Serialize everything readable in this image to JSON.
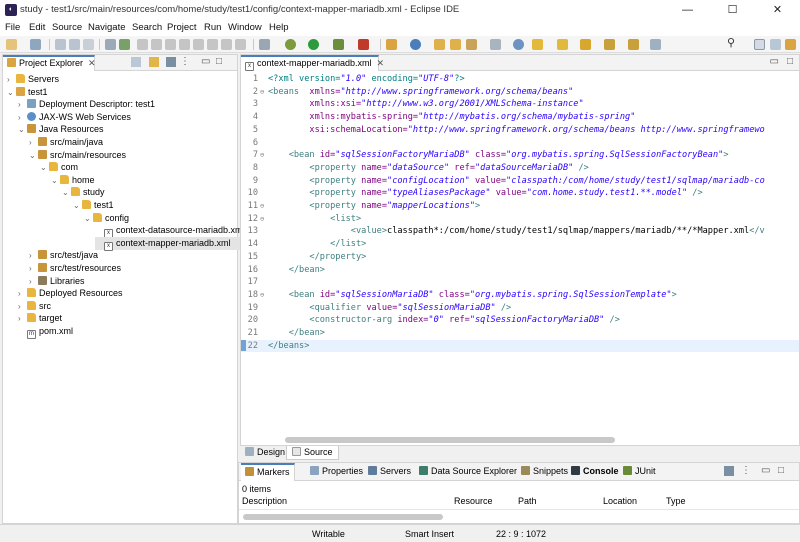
{
  "window": {
    "title": "study - test1/src/main/resources/com/home/study/test1/config/context-mapper-mariadb.xml - Eclipse IDE",
    "minimize": "—",
    "maximize": "☐",
    "close": "✕"
  },
  "menu": [
    "File",
    "Edit",
    "Source",
    "Navigate",
    "Search",
    "Project",
    "Run",
    "Window",
    "Help"
  ],
  "explorer": {
    "title": "Project Explorer",
    "close": "✕",
    "items": [
      {
        "label": "Servers",
        "icon": "folder-icon",
        "toggle": "›",
        "level": 0
      },
      {
        "label": "test1",
        "icon": "project-icon",
        "toggle": "⌄",
        "level": 0
      },
      {
        "label": "Deployment Descriptor: test1",
        "icon": "descriptor-icon",
        "toggle": "›",
        "level": 1
      },
      {
        "label": "JAX-WS Web Services",
        "icon": "web-services-icon",
        "toggle": "›",
        "level": 1
      },
      {
        "label": "Java Resources",
        "icon": "java-resources-icon",
        "toggle": "⌄",
        "level": 1
      },
      {
        "label": "src/main/java",
        "icon": "source-folder-icon",
        "toggle": "›",
        "level": 2
      },
      {
        "label": "src/main/resources",
        "icon": "source-folder-icon",
        "toggle": "⌄",
        "level": 2
      },
      {
        "label": "com",
        "icon": "folder-icon",
        "toggle": "⌄",
        "level": 3
      },
      {
        "label": "home",
        "icon": "folder-icon",
        "toggle": "⌄",
        "level": 4
      },
      {
        "label": "study",
        "icon": "folder-icon",
        "toggle": "⌄",
        "level": 5
      },
      {
        "label": "test1",
        "icon": "folder-icon",
        "toggle": "⌄",
        "level": 6
      },
      {
        "label": "config",
        "icon": "folder-icon",
        "toggle": "⌄",
        "level": 7
      },
      {
        "label": "context-datasource-mariadb.xm",
        "icon": "xml-file-icon",
        "toggle": "",
        "level": 8
      },
      {
        "label": "context-mapper-mariadb.xml",
        "icon": "xml-file-icon",
        "toggle": "",
        "level": 8,
        "selected": true
      },
      {
        "label": "src/test/java",
        "icon": "source-folder-icon",
        "toggle": "›",
        "level": 2
      },
      {
        "label": "src/test/resources",
        "icon": "source-folder-icon",
        "toggle": "›",
        "level": 2
      },
      {
        "label": "Libraries",
        "icon": "library-icon",
        "toggle": "›",
        "level": 2
      },
      {
        "label": "Deployed Resources",
        "icon": "folder-icon",
        "toggle": "›",
        "level": 1
      },
      {
        "label": "src",
        "icon": "folder-icon",
        "toggle": "›",
        "level": 1
      },
      {
        "label": "target",
        "icon": "folder-icon",
        "toggle": "›",
        "level": 1
      },
      {
        "label": "pom.xml",
        "icon": "maven-file-icon",
        "toggle": "",
        "level": 1
      }
    ]
  },
  "editor": {
    "tab": "context-mapper-mariadb.xml",
    "close": "✕",
    "lines": [
      {
        "n": "1",
        "fold": "",
        "segs": [
          [
            "decl",
            "<?xml version="
          ],
          [
            "val",
            "\"1.0\""
          ],
          [
            "decl",
            " encoding="
          ],
          [
            "val",
            "\"UTF-8\""
          ],
          [
            "decl",
            "?>"
          ]
        ]
      },
      {
        "n": "2",
        "fold": "⊖",
        "segs": [
          [
            "tag",
            "<beans  "
          ],
          [
            "attr",
            "xmlns="
          ],
          [
            "val",
            "\"http://www.springframework.org/schema/beans\""
          ]
        ]
      },
      {
        "n": "3",
        "fold": "",
        "segs": [
          [
            "text",
            "        "
          ],
          [
            "attr",
            "xmlns:xsi="
          ],
          [
            "val",
            "\"http://www.w3.org/2001/XMLSchema-instance\""
          ]
        ]
      },
      {
        "n": "4",
        "fold": "",
        "segs": [
          [
            "text",
            "        "
          ],
          [
            "attr",
            "xmlns:mybatis-spring="
          ],
          [
            "val",
            "\"http://mybatis.org/schema/mybatis-spring\""
          ]
        ]
      },
      {
        "n": "5",
        "fold": "",
        "segs": [
          [
            "text",
            "        "
          ],
          [
            "attr",
            "xsi:schemaLocation="
          ],
          [
            "val",
            "\"http://www.springframework.org/schema/beans http://www.springframewo"
          ]
        ]
      },
      {
        "n": "6",
        "fold": "",
        "segs": []
      },
      {
        "n": "7",
        "fold": "⊖",
        "segs": [
          [
            "text",
            "    "
          ],
          [
            "tag",
            "<bean "
          ],
          [
            "attr",
            "id="
          ],
          [
            "val",
            "\"sqlSessionFactoryMariaDB\""
          ],
          [
            "attr",
            " class="
          ],
          [
            "val",
            "\"org.mybatis.spring.SqlSessionFactoryBean\""
          ],
          [
            "tag",
            ">"
          ]
        ]
      },
      {
        "n": "8",
        "fold": "",
        "segs": [
          [
            "text",
            "        "
          ],
          [
            "tag",
            "<property "
          ],
          [
            "attr",
            "name="
          ],
          [
            "val",
            "\"dataSource\""
          ],
          [
            "attr",
            " ref="
          ],
          [
            "val",
            "\"dataSourceMariaDB\""
          ],
          [
            "tag",
            " />"
          ]
        ]
      },
      {
        "n": "9",
        "fold": "",
        "segs": [
          [
            "text",
            "        "
          ],
          [
            "tag",
            "<property "
          ],
          [
            "attr",
            "name="
          ],
          [
            "val",
            "\"configLocation\""
          ],
          [
            "attr",
            " value="
          ],
          [
            "val",
            "\"classpath:/com/home/study/test1/sqlmap/mariadb-co"
          ]
        ]
      },
      {
        "n": "10",
        "fold": "",
        "segs": [
          [
            "text",
            "        "
          ],
          [
            "tag",
            "<property "
          ],
          [
            "attr",
            "name="
          ],
          [
            "val",
            "\"typeAliasesPackage\""
          ],
          [
            "attr",
            " value="
          ],
          [
            "val",
            "\"com.home.study.test1.**.model\""
          ],
          [
            "tag",
            " />"
          ]
        ]
      },
      {
        "n": "11",
        "fold": "⊖",
        "segs": [
          [
            "text",
            "        "
          ],
          [
            "tag",
            "<property "
          ],
          [
            "attr",
            "name="
          ],
          [
            "val",
            "\"mapperLocations\""
          ],
          [
            "tag",
            ">"
          ]
        ]
      },
      {
        "n": "12",
        "fold": "⊖",
        "segs": [
          [
            "text",
            "            "
          ],
          [
            "tag",
            "<list>"
          ]
        ]
      },
      {
        "n": "13",
        "fold": "",
        "segs": [
          [
            "text",
            "                "
          ],
          [
            "tag",
            "<value>"
          ],
          [
            "text",
            "classpath*:/com/home/study/test1/sqlmap/mappers/mariadb/**/*Mapper.xml"
          ],
          [
            "tag",
            "</v"
          ]
        ]
      },
      {
        "n": "14",
        "fold": "",
        "segs": [
          [
            "text",
            "            "
          ],
          [
            "tag",
            "</list>"
          ]
        ]
      },
      {
        "n": "15",
        "fold": "",
        "segs": [
          [
            "text",
            "        "
          ],
          [
            "tag",
            "</property>"
          ]
        ]
      },
      {
        "n": "16",
        "fold": "",
        "segs": [
          [
            "text",
            "    "
          ],
          [
            "tag",
            "</bean>"
          ]
        ]
      },
      {
        "n": "17",
        "fold": "",
        "segs": []
      },
      {
        "n": "18",
        "fold": "⊖",
        "segs": [
          [
            "text",
            "    "
          ],
          [
            "tag",
            "<bean "
          ],
          [
            "attr",
            "id="
          ],
          [
            "val",
            "\"sqlSessionMariaDB\""
          ],
          [
            "attr",
            " class="
          ],
          [
            "val",
            "\"org.mybatis.spring.SqlSessionTemplate\""
          ],
          [
            "tag",
            ">"
          ]
        ]
      },
      {
        "n": "19",
        "fold": "",
        "segs": [
          [
            "text",
            "        "
          ],
          [
            "tag",
            "<qualifier "
          ],
          [
            "attr",
            "value="
          ],
          [
            "val",
            "\"sqlSessionMariaDB\""
          ],
          [
            "tag",
            " />"
          ]
        ]
      },
      {
        "n": "20",
        "fold": "",
        "segs": [
          [
            "text",
            "        "
          ],
          [
            "tag",
            "<constructor-arg "
          ],
          [
            "attr",
            "index="
          ],
          [
            "val",
            "\"0\""
          ],
          [
            "attr",
            " ref="
          ],
          [
            "val",
            "\"sqlSessionFactoryMariaDB\""
          ],
          [
            "tag",
            " />"
          ]
        ]
      },
      {
        "n": "21",
        "fold": "",
        "segs": [
          [
            "text",
            "    "
          ],
          [
            "tag",
            "</bean>"
          ]
        ]
      },
      {
        "n": "22",
        "fold": "",
        "segs": [
          [
            "tag",
            "</beans>"
          ]
        ]
      }
    ],
    "design_tab": "Design",
    "source_tab": "Source"
  },
  "bottom_panel": {
    "tabs": [
      {
        "label": "Markers",
        "icon": "markers-icon",
        "active": true
      },
      {
        "label": "Properties",
        "icon": "properties-icon"
      },
      {
        "label": "Servers",
        "icon": "servers-icon"
      },
      {
        "label": "Data Source Explorer",
        "icon": "data-source-icon"
      },
      {
        "label": "Snippets",
        "icon": "snippets-icon"
      },
      {
        "label": "Console",
        "icon": "console-icon"
      },
      {
        "label": "JUnit",
        "icon": "junit-icon"
      }
    ],
    "count": "0 items",
    "columns": [
      "Description",
      "Resource",
      "Path",
      "Location",
      "Type"
    ]
  },
  "statusbar": {
    "mode": "Writable",
    "insert": "Smart Insert",
    "position": "22 : 9 : 1072"
  },
  "colors": {
    "accent": "#4a7ebb",
    "tag": "#3f7f7f",
    "attr": "#7f007f",
    "value": "#2a00ff"
  }
}
